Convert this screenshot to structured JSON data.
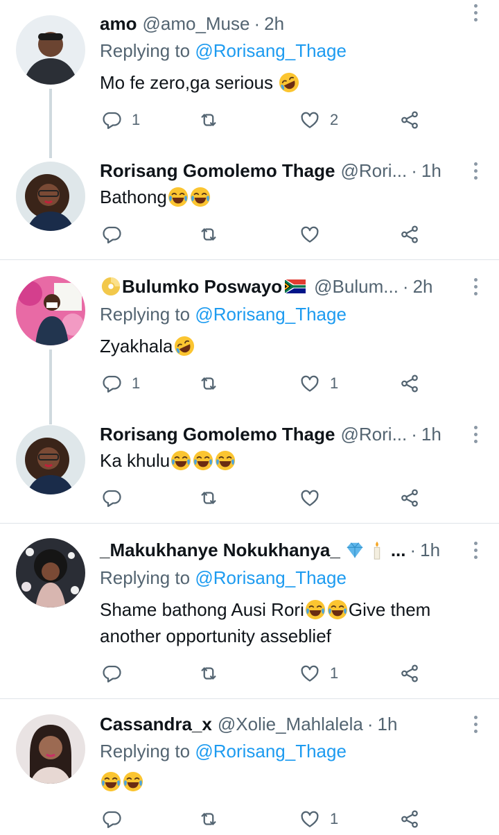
{
  "tweets": [
    {
      "name": "amo",
      "handle": "@amo_Muse",
      "time": "2h",
      "replying_prefix": "Replying to ",
      "replying_to": "@Rorisang_Thage",
      "text": "Mo fe zero,ga serious",
      "emojis": [
        "rofl-emoji"
      ],
      "replies": "1",
      "retweets": "",
      "likes": "2"
    },
    {
      "name": "Rorisang Gomolemo Thage",
      "handle": "@Rori...",
      "time": "1h",
      "text": "Bathong",
      "emojis": [
        "joy-emoji",
        "joy-emoji"
      ],
      "replies": "",
      "retweets": "",
      "likes": ""
    },
    {
      "name": "Bulumko Poswayo",
      "handle": "@Bulum...",
      "time": "2h",
      "name_prefix_emoji": "dvd-emoji",
      "name_suffix_emoji": "south-africa-flag",
      "replying_prefix": "Replying to ",
      "replying_to": "@Rorisang_Thage",
      "text": "Zyakhala",
      "emojis": [
        "rofl-emoji"
      ],
      "replies": "1",
      "retweets": "",
      "likes": "1"
    },
    {
      "name": "Rorisang Gomolemo Thage",
      "handle": "@Rori...",
      "time": "1h",
      "text": "Ka khulu",
      "emojis": [
        "joy-emoji",
        "joy-emoji",
        "joy-emoji"
      ],
      "replies": "",
      "retweets": "",
      "likes": ""
    },
    {
      "name": "_Makukhanye Nokukhanya_",
      "handle": "...",
      "time": "1h",
      "name_suffix_emoji": "gem-emoji candle-emoji",
      "replying_prefix": "Replying to ",
      "replying_to": "@Rorisang_Thage",
      "text_line1_a": "Shame bathong Ausi Rori",
      "text_line1_b": "Give them",
      "text_line2": "another opportunity asseblief",
      "emojis": [
        "joy-emoji",
        "joy-emoji"
      ],
      "replies": "",
      "retweets": "",
      "likes": "1"
    },
    {
      "name": "Cassandra_x",
      "handle": "@Xolie_Mahlalela",
      "time": "1h",
      "replying_prefix": "Replying to ",
      "replying_to": "@Rorisang_Thage",
      "text": "",
      "emojis": [
        "joy-emoji",
        "joy-emoji"
      ],
      "replies": "",
      "retweets": "",
      "likes": "1"
    }
  ],
  "separator": "·",
  "colors": {
    "link": "#1d9bf0",
    "secondary": "#536471",
    "line": "#cfd9de"
  }
}
